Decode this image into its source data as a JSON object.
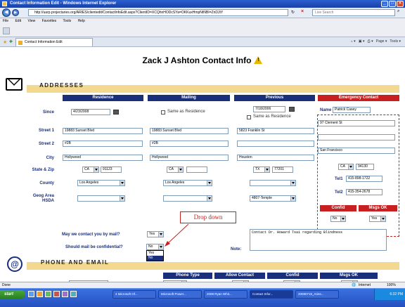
{
  "window": {
    "title": "Contact Information Edit - Windows Internet Explorer"
  },
  "address_bar": {
    "url": "http://uarp.projectaries.org/ARIES/clientedit/ContactInfoEdit.aspx?ClientID=XCQhnHODcSYa=OKKuxHmpNtNBI=ZnDJtY",
    "search_placeholder": "Live Search"
  },
  "menu": [
    "File",
    "Edit",
    "View",
    "Favorites",
    "Tools",
    "Help"
  ],
  "tab": {
    "label": "Contact Information Edit"
  },
  "toolbar_right": [
    "Page ▾",
    "Tools ▾"
  ],
  "page": {
    "title": "Zack J Ashton Contact Info"
  },
  "addresses": {
    "heading": "ADDRESSES",
    "columns": [
      "Residence",
      "Mailing",
      "Previous",
      "Emergency Contact"
    ],
    "row_labels": {
      "since": "Since",
      "street1": "Street 1",
      "street2": "Street 2",
      "city": "City",
      "state_zip": "State & Zip",
      "county": "County",
      "geog_line1": "Geog Area",
      "geog_line2": "HSDA"
    },
    "same_as_residence": "Same as Residence",
    "residence": {
      "since": "4/23/2008",
      "street1": "19883 Sunset Blvd",
      "street2": "#2B",
      "city": "Hollywood",
      "state": "CA",
      "zip": "91123",
      "county": "Los Angeles",
      "geog": ""
    },
    "mailing": {
      "street1": "19883 Sunset Blvd",
      "street2": "#2B",
      "city": "Hollywood",
      "state": "CA",
      "zip": "",
      "county": "Los Angeles",
      "geog": ""
    },
    "previous": {
      "since": "7/18/2006",
      "street1": "5823 Franklin St",
      "street2": "",
      "city": "Houston",
      "state": "TX",
      "zip": "77201",
      "county": "",
      "geog": "4807-Temple"
    }
  },
  "emergency": {
    "name_label": "Name",
    "name": "Patrick Casey",
    "street1": "97 Clement St",
    "street2": "",
    "city": "San Francisco",
    "state": "CA",
    "zip": "94130",
    "tel1_label": "Tel1",
    "tel1": "415-898-1722",
    "tel2_label": "Tel2",
    "tel2": "415-354-2678",
    "confid_label": "Confid",
    "msgs_label": "Msgs OK",
    "confid": "No",
    "msgs": "Yes"
  },
  "mail_prefs": {
    "contact_label": "May we contact you by mail?",
    "contact_value": "Yes",
    "confidential_label": "Should mail be confidential?",
    "confidential_value": "No",
    "dropdown_options": [
      "Yes",
      "No"
    ],
    "note_label": "Note:",
    "note_text": "Contact Dr. Howard Tsai regarding Blindness"
  },
  "annotation": {
    "callout_text": "Drop down"
  },
  "phone": {
    "heading": "PHONE AND EMAIL",
    "columns": [
      "Phone Type",
      "Allow Contact",
      "Confid",
      "Msgs OK"
    ]
  },
  "status_bar": {
    "zone": "Internet",
    "zoom": "100%",
    "left": "Done"
  },
  "taskbar": {
    "start_label": "start",
    "buttons": [
      "4 Microsoft Of...",
      "Microsoft Power...",
      "2008 Ryan Whit...",
      "Contact Infor...",
      "20080715_Aries..."
    ],
    "clock": "6:32 PM"
  },
  "colors": {
    "navy": "#1a2f7a",
    "emergency_red": "#c82020",
    "section_gold": "#f3d890"
  }
}
